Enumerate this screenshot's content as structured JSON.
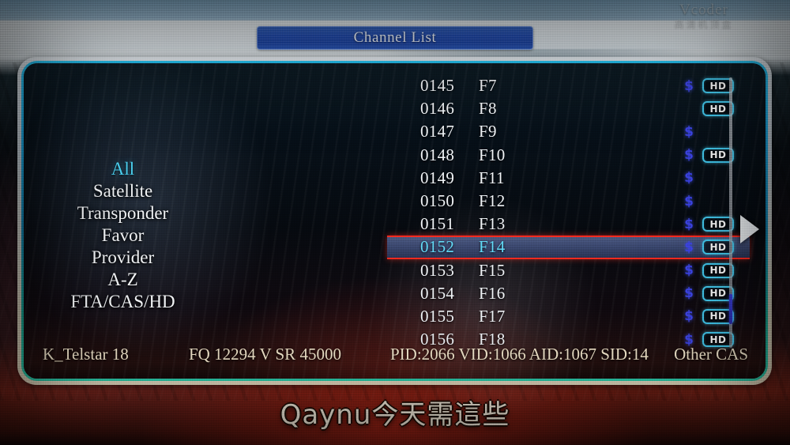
{
  "window": {
    "title": "Channel List",
    "watermark": "Vcoder",
    "watermark_sub": "高清机顶盒"
  },
  "sidebar": {
    "items": [
      {
        "label": "All",
        "active": true
      },
      {
        "label": "Satellite",
        "active": false
      },
      {
        "label": "Transponder",
        "active": false
      },
      {
        "label": "Favor",
        "active": false
      },
      {
        "label": "Provider",
        "active": false
      },
      {
        "label": "A-Z",
        "active": false
      },
      {
        "label": "FTA/CAS/HD",
        "active": false
      }
    ]
  },
  "channel_list": {
    "hd_badge_label": "HD",
    "scrambled_symbol": "$",
    "rows": [
      {
        "number": "0145",
        "name": "F7",
        "scrambled": true,
        "hd": true,
        "selected": false
      },
      {
        "number": "0146",
        "name": "F8",
        "scrambled": false,
        "hd": true,
        "selected": false
      },
      {
        "number": "0147",
        "name": "F9",
        "scrambled": true,
        "hd": false,
        "selected": false
      },
      {
        "number": "0148",
        "name": "F10",
        "scrambled": true,
        "hd": true,
        "selected": false
      },
      {
        "number": "0149",
        "name": "F11",
        "scrambled": true,
        "hd": false,
        "selected": false
      },
      {
        "number": "0150",
        "name": "F12",
        "scrambled": true,
        "hd": false,
        "selected": false
      },
      {
        "number": "0151",
        "name": "F13",
        "scrambled": true,
        "hd": true,
        "selected": false
      },
      {
        "number": "0152",
        "name": "F14",
        "scrambled": true,
        "hd": true,
        "selected": true
      },
      {
        "number": "0153",
        "name": "F15",
        "scrambled": true,
        "hd": true,
        "selected": false
      },
      {
        "number": "0154",
        "name": "F16",
        "scrambled": true,
        "hd": true,
        "selected": false
      },
      {
        "number": "0155",
        "name": "F17",
        "scrambled": true,
        "hd": true,
        "selected": false
      },
      {
        "number": "0156",
        "name": "F18",
        "scrambled": true,
        "hd": true,
        "selected": false
      }
    ]
  },
  "next_page_arrow": "▶",
  "status_bar": {
    "satellite": "K_Telstar 18",
    "transponder": "FQ 12294 V SR 45000",
    "pids": "PID:2066 VID:1066 AID:1067 SID:14",
    "cas": "Other CAS"
  },
  "video_subtitle": "Qaynu今天需這些",
  "colors": {
    "accent_cyan": "#4fd4f2",
    "selection_border_red": "#ff2b20",
    "title_blue": "#1f4fbe",
    "scrambled_blue": "#3f47e8",
    "status_text": "#f4e8cf",
    "panel_border_cyan": "#27c8f5"
  }
}
